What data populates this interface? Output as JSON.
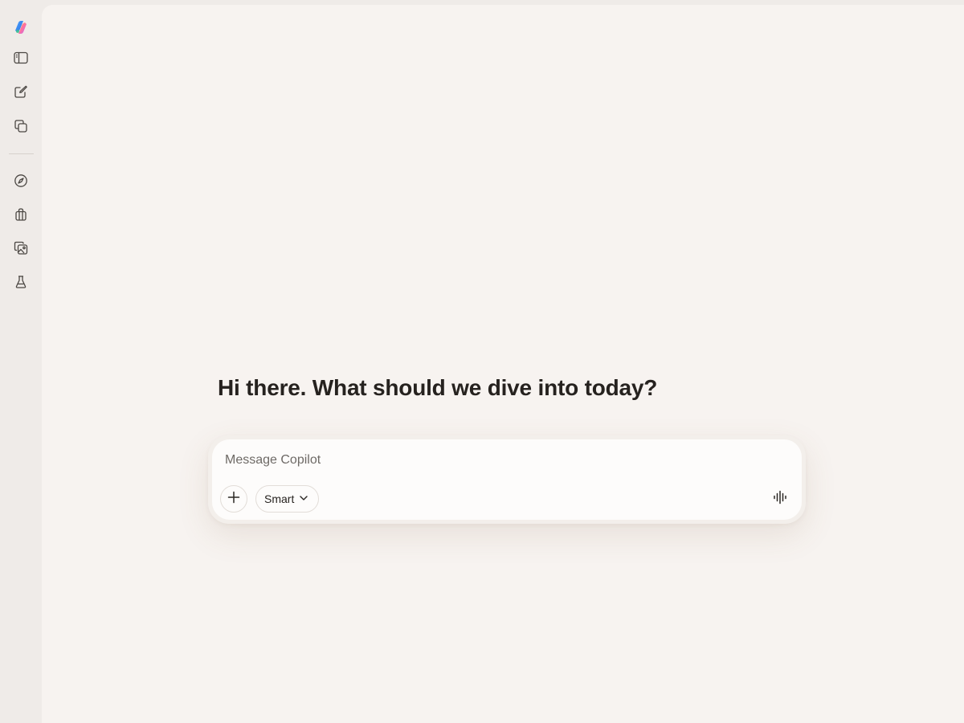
{
  "sidebar": {
    "logo_icon": "copilot-logo-icon",
    "items": [
      {
        "name": "sidebar-toggle",
        "icon": "panel-left-icon"
      },
      {
        "name": "new-chat",
        "icon": "compose-icon"
      },
      {
        "name": "conversations",
        "icon": "copy-stack-icon"
      },
      {
        "name": "discover",
        "icon": "compass-icon"
      },
      {
        "name": "shopping",
        "icon": "shopping-bag-icon"
      },
      {
        "name": "imagine",
        "icon": "gallery-icon"
      },
      {
        "name": "labs",
        "icon": "flask-icon"
      }
    ]
  },
  "main": {
    "greeting": "Hi there. What should we dive into today?",
    "composer": {
      "placeholder": "Message Copilot",
      "value": "",
      "mode_label": "Smart",
      "plus_icon": "plus-icon",
      "mode_icon": "chevron-down-icon",
      "voice_icon": "voice-waveform-icon"
    }
  },
  "colors": {
    "sidebar_bg": "#efebe8",
    "main_bg": "#f7f3f0",
    "composer_bg": "#fdfcfb",
    "text": "#26221f",
    "placeholder": "#6e6a66"
  }
}
